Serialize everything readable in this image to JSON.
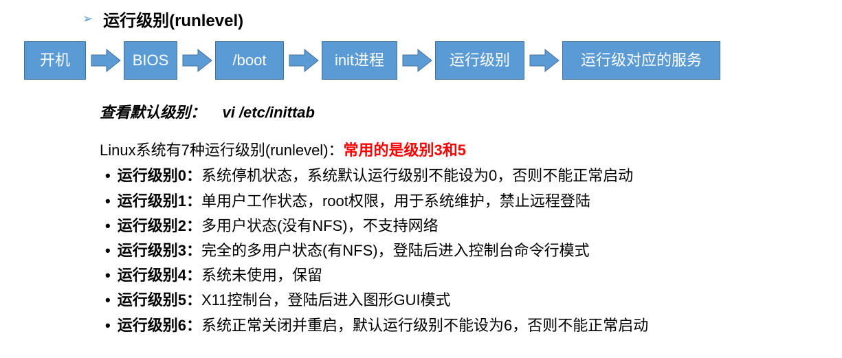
{
  "title": "运行级别(runlevel)",
  "flow": {
    "box1": "开机",
    "box2": "BIOS",
    "box3": "/boot",
    "box4": "init进程",
    "box5": "运行级别",
    "box6": "运行级对应的服务"
  },
  "subtitle_label": "查看默认级别：",
  "subtitle_cmd": "vi /etc/inittab",
  "intro_prefix": "Linux系统有7种运行级别(runlevel)：",
  "intro_emphasis": "常用的是级别3和5",
  "levels": [
    {
      "label": "运行级别0：",
      "desc": "系统停机状态，系统默认运行级别不能设为0，否则不能正常启动"
    },
    {
      "label": "运行级别1：",
      "desc": "单用户工作状态，root权限，用于系统维护，禁止远程登陆"
    },
    {
      "label": "运行级别2：",
      "desc": "多用户状态(没有NFS)，不支持网络"
    },
    {
      "label": "运行级别3：",
      "desc": "完全的多用户状态(有NFS)，登陆后进入控制台命令行模式"
    },
    {
      "label": "运行级别4：",
      "desc": "系统未使用，保留"
    },
    {
      "label": "运行级别5：",
      "desc": "X11控制台，登陆后进入图形GUI模式"
    },
    {
      "label": "运行级别6：",
      "desc": "系统正常关闭并重启，默认运行级别不能设为6，否则不能正常启动"
    }
  ]
}
